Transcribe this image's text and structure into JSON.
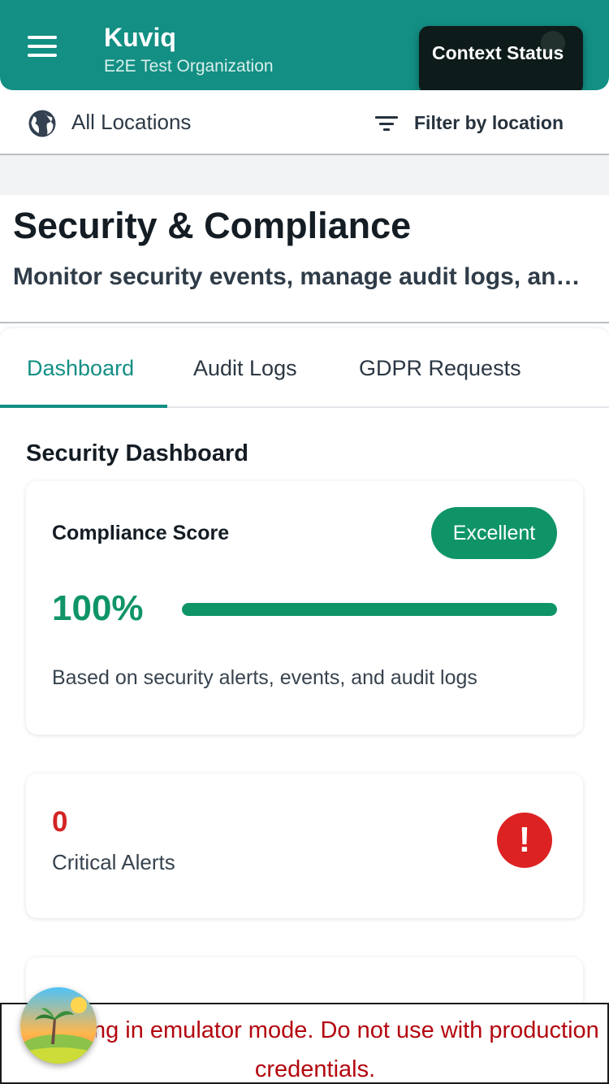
{
  "header": {
    "app_title": "Kuviq",
    "org_name": "E2E Test Organization",
    "context_status": "Context Status",
    "brand_color": "#138f84"
  },
  "location_bar": {
    "all_locations": "All Locations",
    "filter_label": "Filter by location",
    "icons": [
      "globe-icon",
      "filter-icon"
    ]
  },
  "page": {
    "title": "Security & Compliance",
    "subtitle": "Monitor security events, manage audit logs, and handle GDPR requests"
  },
  "tabs": [
    {
      "label": "Dashboard",
      "active": true
    },
    {
      "label": "Audit Logs",
      "active": false
    },
    {
      "label": "GDPR Requests",
      "active": false
    }
  ],
  "dashboard": {
    "section_title": "Security Dashboard",
    "compliance": {
      "label": "Compliance Score",
      "badge": "Excellent",
      "value": "100%",
      "progress_fraction": 1.0,
      "note": "Based on security alerts, events, and audit logs",
      "color": "#0f9468"
    },
    "critical_alerts": {
      "count": "0",
      "label": "Critical Alerts",
      "icon": "exclamation-icon",
      "icon_glyph": "!",
      "color": "#dc2222"
    }
  },
  "emulator_warning": {
    "text": "Running in emulator mode. Do not use with production credentials.",
    "color": "#b3070f"
  }
}
